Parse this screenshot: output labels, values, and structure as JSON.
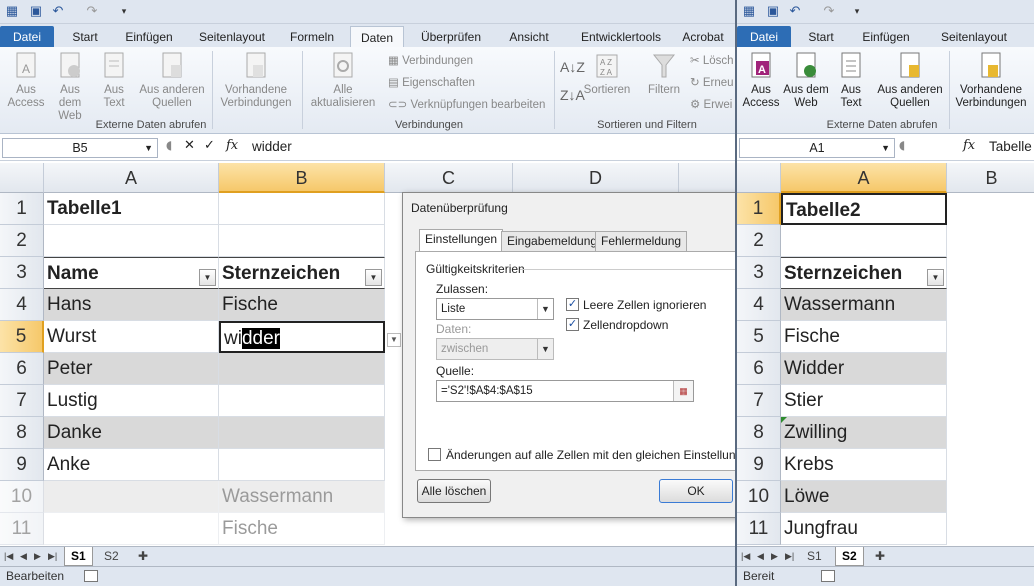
{
  "left_window": {
    "tabs": [
      "Datei",
      "Start",
      "Einfügen",
      "Seitenlayout",
      "Formeln",
      "Daten",
      "Überprüfen",
      "Ansicht",
      "Entwicklertools",
      "Acrobat"
    ],
    "ribbon": {
      "external_group_label": "Externe Daten abrufen",
      "btn_access": "Aus Access",
      "btn_web": "Aus dem Web",
      "btn_text": "Aus Text",
      "btn_other": "Aus anderen Quellen",
      "btn_existing": "Vorhandene Verbindungen",
      "connections_group_label": "Verbindungen",
      "btn_refresh": "Alle aktualisieren",
      "conn_connections": "Verbindungen",
      "conn_properties": "Eigenschaften",
      "conn_edit_links": "Verknüpfungen bearbeiten",
      "sort_group_label": "Sortieren und Filtern",
      "btn_sort": "Sortieren",
      "btn_filter": "Filtern",
      "btn_clear": "Lösch",
      "btn_reapply": "Erneu",
      "btn_advanced": "Erwei"
    },
    "name_box": "B5",
    "formula": "widder",
    "columns": [
      "A",
      "B",
      "C",
      "D"
    ],
    "rows": [
      {
        "n": "1",
        "a": "Tabelle1",
        "b": ""
      },
      {
        "n": "2",
        "a": "",
        "b": ""
      },
      {
        "n": "3",
        "a": "Name",
        "b": "Sternzeichen"
      },
      {
        "n": "4",
        "a": "Hans",
        "b": "Fische"
      },
      {
        "n": "5",
        "a": "Wurst",
        "b_plain": "wi",
        "b_sel": "dder"
      },
      {
        "n": "6",
        "a": "Peter",
        "b": ""
      },
      {
        "n": "7",
        "a": "Lustig",
        "b": ""
      },
      {
        "n": "8",
        "a": "Danke",
        "b": ""
      },
      {
        "n": "9",
        "a": "Anke",
        "b": ""
      },
      {
        "n": "10",
        "a": "",
        "b": "Wassermann"
      },
      {
        "n": "11",
        "a": "",
        "b": "Fische"
      }
    ],
    "sheet_tabs": [
      "S1",
      "S2"
    ],
    "status": "Bearbeiten"
  },
  "dialog": {
    "title": "Datenüberprüfung",
    "tabs": [
      "Einstellungen",
      "Eingabemeldung",
      "Fehlermeldung"
    ],
    "section": "Gültigkeitskriterien",
    "allow_label": "Zulassen:",
    "allow_value": "Liste",
    "ignore_blank": "Leere Zellen ignorieren",
    "dropdown": "Zellendropdown",
    "data_label": "Daten:",
    "data_value": "zwischen",
    "source_label": "Quelle:",
    "source_value": "='S2'!$A$4:$A$15",
    "apply_all": "Änderungen auf alle Zellen mit den gleichen Einstellungen anw",
    "clear_all": "Alle löschen",
    "ok": "OK"
  },
  "right_window": {
    "tabs": [
      "Datei",
      "Start",
      "Einfügen",
      "Seitenlayout"
    ],
    "ribbon": {
      "btn_access": "Aus Access",
      "btn_web": "Aus dem Web",
      "btn_text": "Aus Text",
      "btn_other": "Aus anderen Quellen",
      "btn_existing": "Vorhandene Verbindungen",
      "external_group_label": "Externe Daten abrufen"
    },
    "name_box": "A1",
    "formula": "Tabelle",
    "columns": [
      "A",
      "B"
    ],
    "rows": [
      {
        "n": "1",
        "a": "Tabelle2"
      },
      {
        "n": "2",
        "a": ""
      },
      {
        "n": "3",
        "a": "Sternzeichen"
      },
      {
        "n": "4",
        "a": "Wassermann"
      },
      {
        "n": "5",
        "a": "Fische"
      },
      {
        "n": "6",
        "a": "Widder"
      },
      {
        "n": "7",
        "a": "Stier"
      },
      {
        "n": "8",
        "a": "Zwilling"
      },
      {
        "n": "9",
        "a": "Krebs"
      },
      {
        "n": "10",
        "a": "Löwe"
      },
      {
        "n": "11",
        "a": "Jungfrau"
      }
    ],
    "sheet_tabs": [
      "S1",
      "S2"
    ],
    "status": "Bereit"
  },
  "colors": {
    "file_tab": "#2d6db5",
    "selected_header": "#f6c86a",
    "band": "#d9d9d9"
  }
}
